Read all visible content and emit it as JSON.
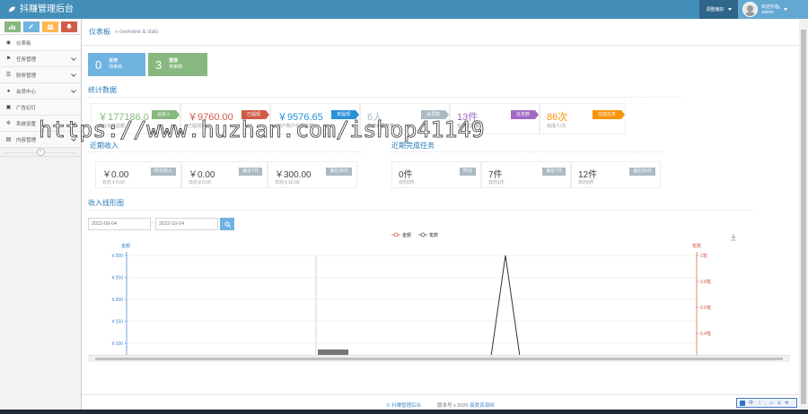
{
  "header": {
    "brand": "抖赚管理后台",
    "theme_label": "调整偏好",
    "welcome": "欢迎光临,",
    "username": "admin"
  },
  "sidebar": {
    "shortcuts": [
      {
        "icon": "stats-icon",
        "color": "#87b87f"
      },
      {
        "icon": "pencil-icon",
        "color": "#6fb3e0"
      },
      {
        "icon": "group-icon",
        "color": "#ffb752"
      },
      {
        "icon": "bell-icon",
        "color": "#d15b47"
      }
    ],
    "items": [
      {
        "label": "仪表板",
        "icon": "dashboard-icon",
        "arrow": false
      },
      {
        "label": "任务管理",
        "icon": "flag-icon",
        "arrow": true
      },
      {
        "label": "财务管理",
        "icon": "list-icon",
        "arrow": true
      },
      {
        "label": "会员中心",
        "icon": "user-icon",
        "arrow": true
      },
      {
        "label": "广告幻灯",
        "icon": "picture-icon",
        "arrow": false
      },
      {
        "label": "系统设置",
        "icon": "gear-icon",
        "arrow": true
      },
      {
        "label": "内容管理",
        "icon": "book-icon",
        "arrow": true
      }
    ]
  },
  "breadcrumb": {
    "title": "仪表板",
    "sub": "» overview & stats"
  },
  "infoboxes": [
    {
      "value": "0",
      "line1": "任务",
      "line2": "待审核",
      "color": "#6fb3e0"
    },
    {
      "value": "3",
      "line1": "提现",
      "line2": "待审核",
      "color": "#87b87f"
    }
  ],
  "stats": {
    "heading": "统计数据",
    "cards": [
      {
        "value": "￥177186.0",
        "desc": "平台充值总额",
        "tag": "总收入",
        "color": "#87b87f",
        "tag_color": "#87b87f"
      },
      {
        "value": "￥9760.00",
        "desc": "已提现金",
        "tag": "已提现",
        "color": "#d15b47",
        "tag_color": "#d15b47"
      },
      {
        "value": "￥9576.65",
        "desc": "用户账户余额总额",
        "tag": "未提现",
        "color": "#2a91d8",
        "tag_color": "#2a91d8"
      },
      {
        "value": "6人",
        "desc": "普通会员数量",
        "tag": "会员数",
        "color": "#abbac3",
        "tag_color": "#abbac3"
      },
      {
        "value": "13件",
        "desc": "任务总数量",
        "tag": "任务数",
        "color": "#a069c3",
        "tag_color": "#a069c3"
      },
      {
        "value": "86次",
        "desc": "完成人/次",
        "tag": "完成任务",
        "color": "#f89406",
        "tag_color": "#f89406"
      }
    ]
  },
  "income": {
    "heading": "近期收入",
    "cards": [
      {
        "value": "￥0.00",
        "desc": "日均￥0.00",
        "tag": "昨日收入"
      },
      {
        "value": "￥0.00",
        "desc": "日均￥0.00",
        "tag": "最近7日"
      },
      {
        "value": "￥300.00",
        "desc": "日均￥10.00",
        "tag": "最近30日"
      }
    ]
  },
  "tasks": {
    "heading": "近期完成任务",
    "cards": [
      {
        "value": "0件",
        "desc": "日均0件",
        "tag": "昨日"
      },
      {
        "value": "7件",
        "desc": "日均1件",
        "tag": "最近7日"
      },
      {
        "value": "12件",
        "desc": "日均0件",
        "tag": "最近30日"
      }
    ]
  },
  "income_chart": {
    "heading": "收入线形图",
    "date_from": "2022-09-04",
    "date_to": "2022-10-04",
    "separator": "-",
    "download_icon": "download-icon"
  },
  "chart_data": {
    "type": "line",
    "legend": [
      "金额",
      "笔数"
    ],
    "legend_placement": "top-center",
    "y_left_label": "金额",
    "y_right_label": "笔数",
    "y_left_ticks": [
      "￥300",
      "￥250",
      "￥200",
      "￥150",
      "￥100"
    ],
    "y_right_ticks": [
      "1笔",
      "0.8笔",
      "0.6笔",
      "0.4笔"
    ],
    "ylim_left": [
      0,
      300
    ],
    "ylim_right": [
      0,
      1
    ],
    "grid": true,
    "series": [
      {
        "name": "金额",
        "color": "#333333",
        "values": [
          0,
          0,
          0,
          0,
          0,
          0,
          0,
          0,
          0,
          0,
          0,
          0,
          0,
          0,
          0,
          0,
          0,
          0,
          0,
          0,
          300,
          0,
          0,
          0,
          0,
          0,
          0,
          0,
          0,
          0,
          0
        ]
      }
    ],
    "tooltip_visible": true
  },
  "footer": {
    "brand": "© 抖赚管理后台",
    "version": "版本号 v 2020",
    "link": "晨景资源网"
  },
  "tray_icons": [
    "logo-icon",
    "chinese-icon",
    "moon-icon",
    "comma-icon",
    "keyboard-icon",
    "user-icon",
    "settings-icon"
  ],
  "watermark": "https://www.huzhan.com/ishop41149"
}
